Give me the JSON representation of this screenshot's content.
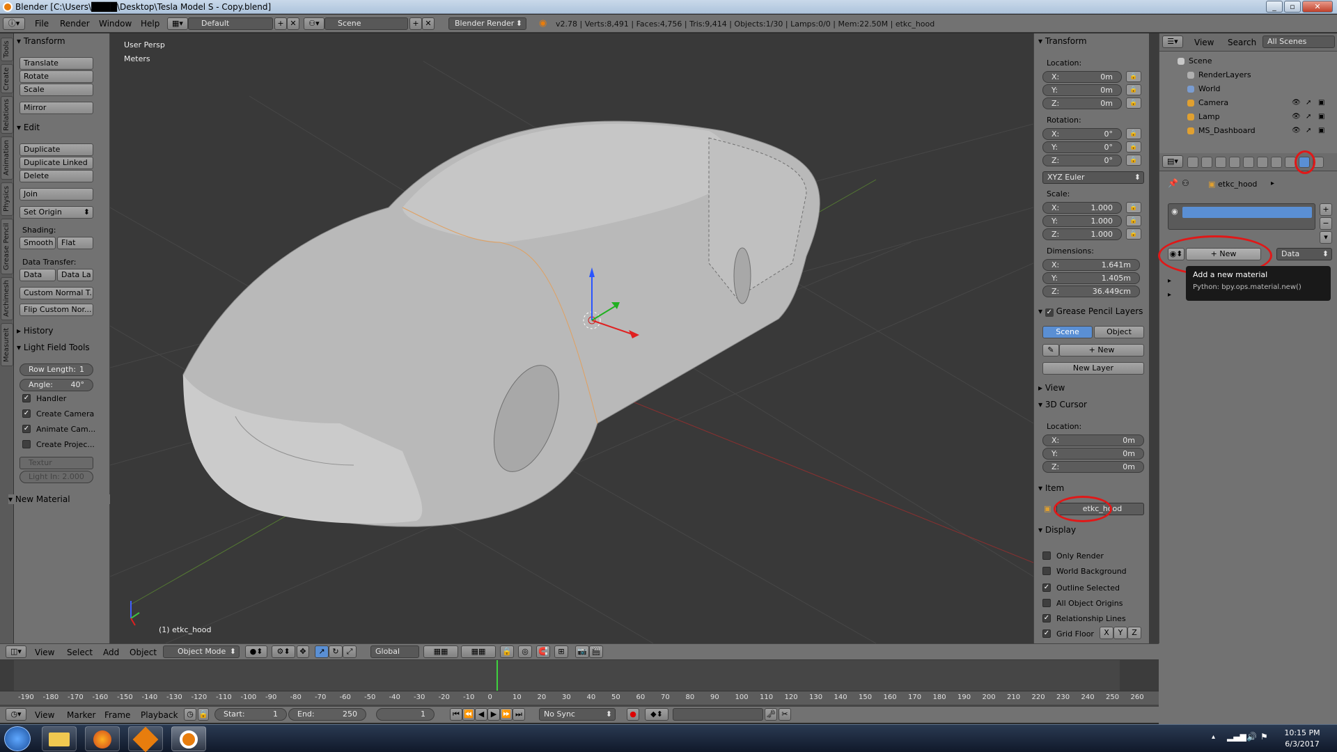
{
  "window": {
    "title": "Blender [C:\\Users\\████\\Desktop\\Tesla Model S - Copy.blend]"
  },
  "info_header": {
    "menus": [
      "File",
      "Render",
      "Window",
      "Help"
    ],
    "layout": "Default",
    "scene": "Scene",
    "engine": "Blender Render",
    "stats": "v2.78 | Verts:8,491 | Faces:4,756 | Tris:9,414 | Objects:1/30 | Lamps:0/0 | Mem:22.50M | etkc_hood"
  },
  "left_tabs": [
    "Tools",
    "Create",
    "Relations",
    "Animation",
    "Physics",
    "Grease Pencil",
    "Archimesh",
    "Measureit"
  ],
  "tool_shelf": {
    "transform_header": "Transform",
    "translate": "Translate",
    "rotate": "Rotate",
    "scale": "Scale",
    "mirror": "Mirror",
    "edit_header": "Edit",
    "duplicate": "Duplicate",
    "duplicate_linked": "Duplicate Linked",
    "delete": "Delete",
    "join": "Join",
    "set_origin": "Set Origin",
    "shading_label": "Shading:",
    "smooth": "Smooth",
    "flat": "Flat",
    "data_transfer_label": "Data Transfer:",
    "data": "Data",
    "data_la": "Data La",
    "custom_normal": "Custom Normal T...",
    "flip_custom": "Flip Custom Nor...",
    "history_header": "History",
    "lightfield_header": "Light Field Tools",
    "row_length_label": "Row Length:",
    "row_length_value": "1",
    "angle_label": "Angle:",
    "angle_value": "40°",
    "handler": "Handler",
    "create_camera": "Create Camera",
    "animate_camera": "Animate Cam...",
    "create_projector": "Create Projec...",
    "texture": "Textur",
    "light_in": "Light In: 2.000",
    "new_material_header": "New Material"
  },
  "viewport": {
    "view_name": "User Persp",
    "units": "Meters",
    "object_label": "(1) etkc_hood"
  },
  "n_panel": {
    "transform_header": "Transform",
    "location_label": "Location:",
    "location": [
      {
        "axis": "X:",
        "value": "0m"
      },
      {
        "axis": "Y:",
        "value": "0m"
      },
      {
        "axis": "Z:",
        "value": "0m"
      }
    ],
    "rotation_label": "Rotation:",
    "rotation": [
      {
        "axis": "X:",
        "value": "0°"
      },
      {
        "axis": "Y:",
        "value": "0°"
      },
      {
        "axis": "Z:",
        "value": "0°"
      }
    ],
    "rotation_mode": "XYZ Euler",
    "scale_label": "Scale:",
    "scale": [
      {
        "axis": "X:",
        "value": "1.000"
      },
      {
        "axis": "Y:",
        "value": "1.000"
      },
      {
        "axis": "Z:",
        "value": "1.000"
      }
    ],
    "dimensions_label": "Dimensions:",
    "dimensions": [
      {
        "axis": "X:",
        "value": "1.641m"
      },
      {
        "axis": "Y:",
        "value": "1.405m"
      },
      {
        "axis": "Z:",
        "value": "36.449cm"
      }
    ],
    "grease_header": "Grease Pencil Layers",
    "scene_btn": "Scene",
    "object_btn": "Object",
    "new_btn": "New",
    "new_layer_btn": "New Layer",
    "view_header": "View",
    "cursor_header": "3D Cursor",
    "cursor_location_label": "Location:",
    "cursor_location": [
      {
        "axis": "X:",
        "value": "0m"
      },
      {
        "axis": "Y:",
        "value": "0m"
      },
      {
        "axis": "Z:",
        "value": "0m"
      }
    ],
    "item_header": "Item",
    "item_name": "etkc_hood",
    "display_header": "Display",
    "display_options": [
      {
        "label": "Only Render",
        "checked": false
      },
      {
        "label": "World Background",
        "checked": false
      },
      {
        "label": "Outline Selected",
        "checked": true
      },
      {
        "label": "All Object Origins",
        "checked": false
      },
      {
        "label": "Relationship Lines",
        "checked": true
      },
      {
        "label": "Grid Floor",
        "checked": true
      }
    ],
    "grid_axes": [
      "X",
      "Y",
      "Z"
    ]
  },
  "outliner": {
    "view": "View",
    "search": "Search",
    "filter": "All Scenes",
    "rows": [
      {
        "label": "Scene",
        "color": "#c8c8c8"
      },
      {
        "label": "RenderLayers",
        "color": "#b0b0b0"
      },
      {
        "label": "World",
        "color": "#7a9cd0"
      },
      {
        "label": "Camera",
        "color": "#e0a030"
      },
      {
        "label": "Lamp",
        "color": "#e0a030"
      },
      {
        "label": "MS_Dashboard",
        "color": "#e0a030"
      }
    ]
  },
  "properties": {
    "breadcrumb": "etkc_hood",
    "new_button": "New",
    "data_dropdown": "Data",
    "tooltip_title": "Add a new material",
    "tooltip_python": "Python: bpy.ops.material.new()"
  },
  "viewport_header": {
    "menus": [
      "View",
      "Select",
      "Add",
      "Object"
    ],
    "mode": "Object Mode",
    "orientation": "Global"
  },
  "timeline": {
    "ticks": [
      "-190",
      "-180",
      "-170",
      "-160",
      "-150",
      "-140",
      "-130",
      "-120",
      "-110",
      "-100",
      "-90",
      "-80",
      "-70",
      "-60",
      "-50",
      "-40",
      "-30",
      "-20",
      "-10",
      "0",
      "10",
      "20",
      "30",
      "40",
      "50",
      "60",
      "70",
      "80",
      "90",
      "100",
      "110",
      "120",
      "130",
      "140",
      "150",
      "160",
      "170",
      "180",
      "190",
      "200",
      "210",
      "220",
      "230",
      "240",
      "250",
      "260"
    ],
    "current_frame_value": 1,
    "menus": [
      "View",
      "Marker",
      "Frame",
      "Playback"
    ],
    "start_label": "Start:",
    "start_value": "1",
    "end_label": "End:",
    "end_value": "250",
    "current_frame": "1",
    "sync": "No Sync"
  },
  "taskbar": {
    "time": "10:15 PM",
    "date": "6/3/2017"
  },
  "colors": {
    "panel": "#727272",
    "viewport": "#393939",
    "accent": "#5a8fd4",
    "highlight_circle": "#e01818"
  }
}
